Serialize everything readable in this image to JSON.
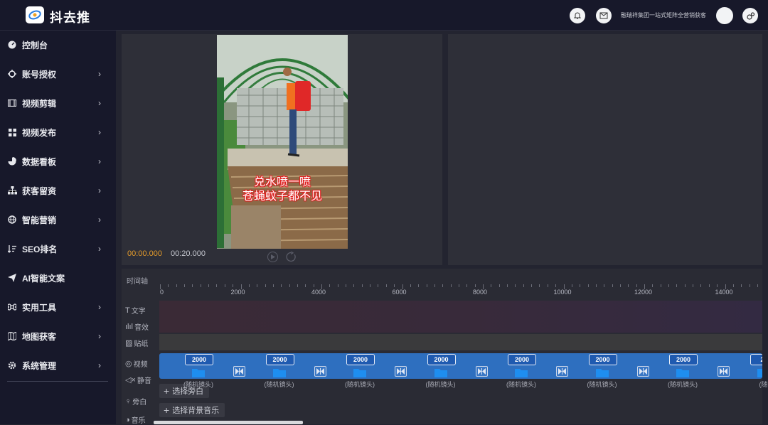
{
  "header": {
    "brand": "抖去推",
    "tagline": "融瑞祥集团一站式矩阵全营销获客"
  },
  "sidebar": {
    "items": [
      {
        "label": "控制台",
        "icon": "dashboard-icon",
        "chevron": false
      },
      {
        "label": "账号授权",
        "icon": "crosshair-icon",
        "chevron": true
      },
      {
        "label": "视频剪辑",
        "icon": "film-icon",
        "chevron": true
      },
      {
        "label": "视频发布",
        "icon": "grid-icon",
        "chevron": true
      },
      {
        "label": "数据看板",
        "icon": "pie-chart-icon",
        "chevron": true
      },
      {
        "label": "获客留资",
        "icon": "org-chart-icon",
        "chevron": true
      },
      {
        "label": "智能营销",
        "icon": "globe-icon",
        "chevron": true
      },
      {
        "label": "SEO排名",
        "icon": "sort-icon",
        "chevron": true
      },
      {
        "label": "AI智能文案",
        "icon": "send-icon",
        "chevron": false
      },
      {
        "label": "实用工具",
        "icon": "command-icon",
        "chevron": true
      },
      {
        "label": "地图获客",
        "icon": "map-icon",
        "chevron": true
      },
      {
        "label": "系统管理",
        "icon": "gear-icon",
        "chevron": true
      }
    ]
  },
  "player": {
    "caption_line1": "兑水喷一喷",
    "caption_line2": "苍蝇蚊子都不见",
    "current_time": "00:00.000",
    "total_time": "00:20.000"
  },
  "timeline": {
    "title": "时间轴",
    "ruler": [
      "0",
      "2000",
      "4000",
      "6000",
      "8000",
      "10000",
      "12000",
      "14000"
    ],
    "tracks": {
      "text": "文字",
      "sound": "音效",
      "sticker": "贴纸",
      "video": "视频",
      "mute": "静音",
      "voiceover": "旁白",
      "music": "音乐"
    },
    "clips": [
      {
        "duration": "2000",
        "label": "(随机镜头)"
      },
      {
        "duration": "2000",
        "label": "(随机镜头)"
      },
      {
        "duration": "2000",
        "label": "(随机镜头)"
      },
      {
        "duration": "2000",
        "label": "(随机镜头)"
      },
      {
        "duration": "2000",
        "label": "(随机镜头)"
      },
      {
        "duration": "2000",
        "label": "(随机镜头)"
      },
      {
        "duration": "2000",
        "label": "(随机镜头)"
      },
      {
        "duration": "20",
        "label": "(随"
      }
    ],
    "select_voiceover": "选择旁白",
    "select_music": "选择背景音乐"
  }
}
